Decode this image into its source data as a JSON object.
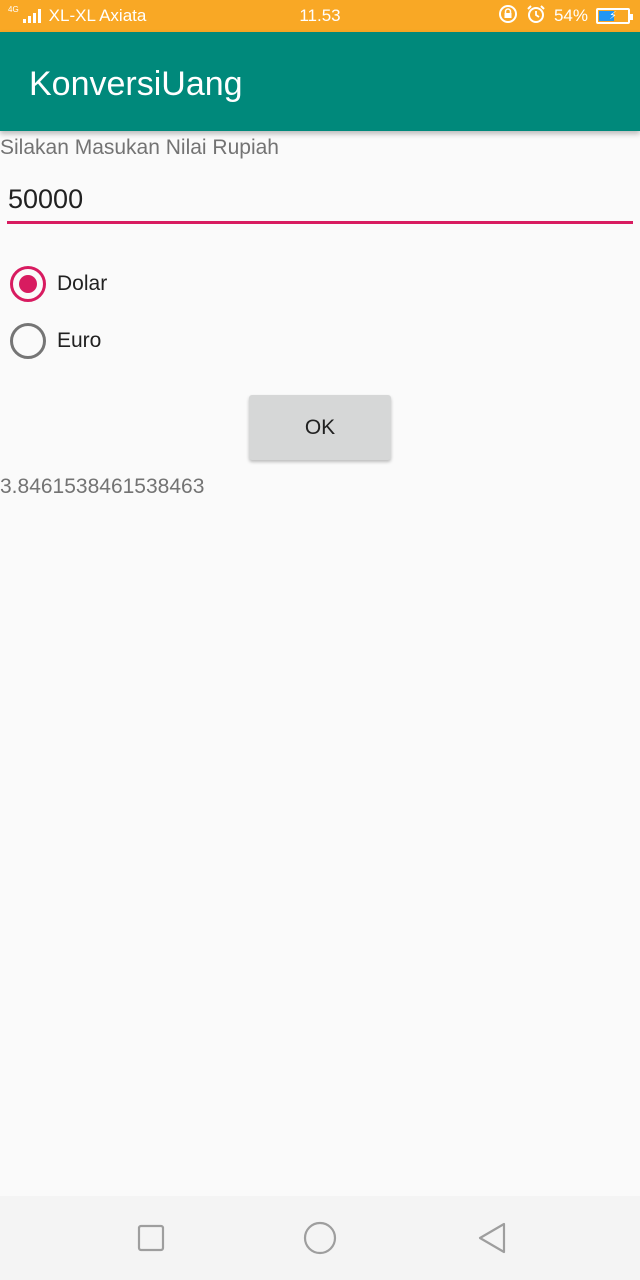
{
  "status_bar": {
    "network_badge": "4G",
    "carrier": "XL-XL Axiata",
    "time": "11.53",
    "battery_percent": "54%",
    "battery_level": 0.54,
    "icons": [
      "lock-rotate-icon",
      "alarm-icon",
      "battery-charging-icon"
    ]
  },
  "app_bar": {
    "title": "KonversiUang"
  },
  "form": {
    "prompt": "Silakan Masukan Nilai Rupiah",
    "amount_value": "50000"
  },
  "options": [
    {
      "label": "Dolar",
      "checked": true
    },
    {
      "label": "Euro",
      "checked": false
    }
  ],
  "ok_button": {
    "label": "OK"
  },
  "result": "3.8461538461538463",
  "nav_bar": {
    "icons": [
      "recents-icon",
      "home-icon",
      "back-icon"
    ]
  },
  "colors": {
    "status_bar": "#f9a825",
    "app_bar": "#00897b",
    "accent": "#d81b60"
  }
}
